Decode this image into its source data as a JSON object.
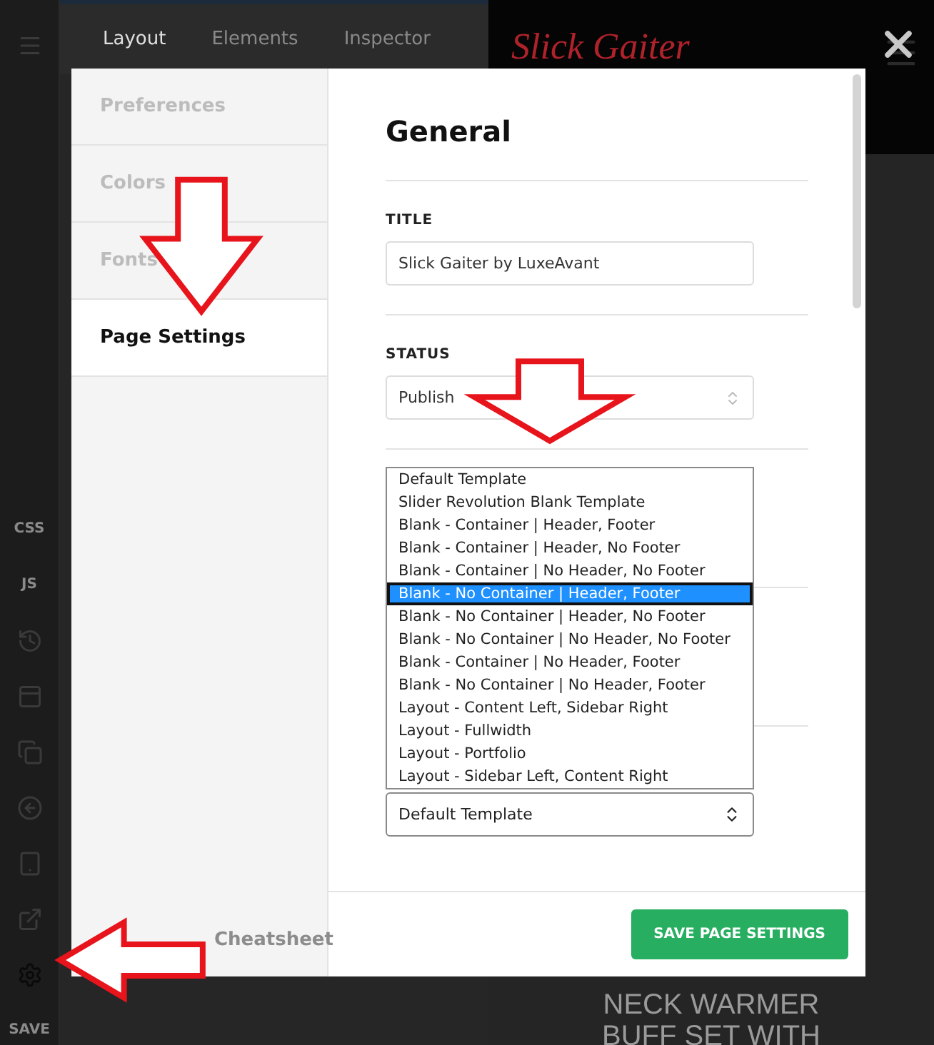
{
  "rail": {
    "css_label": "CSS",
    "js_label": "JS",
    "save_label": "SAVE"
  },
  "editor_tabs": [
    {
      "label": "Layout",
      "selected": true
    },
    {
      "label": "Elements",
      "selected": false
    },
    {
      "label": "Inspector",
      "selected": false
    }
  ],
  "preview": {
    "logo": "Slick Gaiter",
    "lines": [
      "NECK WARMER",
      "BUFF SET WITH"
    ]
  },
  "modal": {
    "nav": [
      {
        "label": "Preferences",
        "selected": false
      },
      {
        "label": "Colors",
        "selected": false
      },
      {
        "label": "Fonts",
        "selected": false
      },
      {
        "label": "Page Settings",
        "selected": true
      }
    ],
    "cheatsheet": "Cheatsheet",
    "heading": "General",
    "fields": [
      {
        "kind": "text",
        "label": "TITLE",
        "value": "Slick Gaiter by LuxeAvant"
      },
      {
        "kind": "select",
        "label": "STATUS",
        "value": "Publish"
      }
    ],
    "template": {
      "value": "Default Template",
      "options": [
        {
          "label": "Default Template",
          "highlighted": false
        },
        {
          "label": "Slider Revolution Blank Template",
          "highlighted": false
        },
        {
          "label": "Blank - Container | Header, Footer",
          "highlighted": false
        },
        {
          "label": "Blank - Container | Header, No Footer",
          "highlighted": false
        },
        {
          "label": "Blank - Container | No Header, No Footer",
          "highlighted": false
        },
        {
          "label": "Blank - No Container | Header, Footer",
          "highlighted": true
        },
        {
          "label": "Blank - No Container | Header, No Footer",
          "highlighted": false
        },
        {
          "label": "Blank - No Container | No Header, No Footer",
          "highlighted": false
        },
        {
          "label": "Blank - Container | No Header, Footer",
          "highlighted": false
        },
        {
          "label": "Blank - No Container | No Header, Footer",
          "highlighted": false
        },
        {
          "label": "Layout - Content Left, Sidebar Right",
          "highlighted": false
        },
        {
          "label": "Layout - Fullwidth",
          "highlighted": false
        },
        {
          "label": "Layout - Portfolio",
          "highlighted": false
        },
        {
          "label": "Layout - Sidebar Left, Content Right",
          "highlighted": false
        }
      ]
    },
    "save_button": "SAVE PAGE SETTINGS"
  }
}
